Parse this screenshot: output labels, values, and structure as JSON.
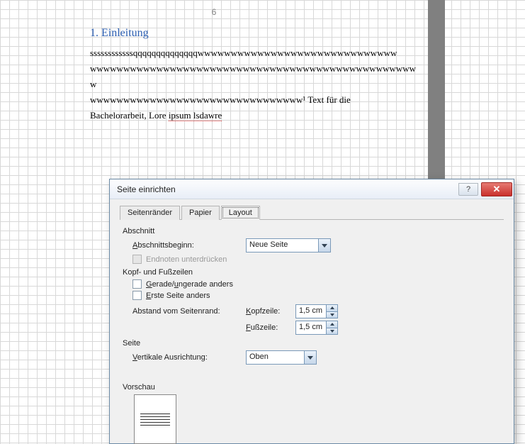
{
  "document": {
    "page_number": "6",
    "heading": "1. Einleitung",
    "line1": "ssssssssssssqqqqqqqqqqqqqqwwwwwwwwwwwwwwwwwwwwwwwwwwwwww",
    "line2": "wwwwwwwwwwwwwwwwwwwwwwwwwwwwwwwwwwwwwwwwwwwwwwwwww",
    "line3a": "wwwwwwwwwwwwwwwwwwwwwwwwwwwwwwww",
    "line3b": "¹ Text für die",
    "line4a": "Bachelorarbeit, Lore ",
    "line4b": "ipsum lsdawre"
  },
  "dialog": {
    "title": "Seite einrichten",
    "tabs": {
      "t1": "Seitenränder",
      "t2": "Papier",
      "t3": "Layout"
    },
    "section": {
      "group": "Abschnitt",
      "start_label": "Abschnittsbeginn:",
      "start_value": "Neue Seite",
      "suppress_endnotes": "Endnoten unterdrücken"
    },
    "hf": {
      "group": "Kopf- und Fußzeilen",
      "odd_even": "Gerade/ungerade anders",
      "first_page": "Erste Seite anders",
      "margin_label": "Abstand vom Seitenrand:",
      "header_label": "Kopfzeile:",
      "footer_label": "Fußzeile:",
      "header_value": "1,5 cm",
      "footer_value": "1,5 cm"
    },
    "page": {
      "group": "Seite",
      "valign_label": "Vertikale Ausrichtung:",
      "valign_value": "Oben"
    },
    "preview": {
      "group": "Vorschau"
    }
  }
}
